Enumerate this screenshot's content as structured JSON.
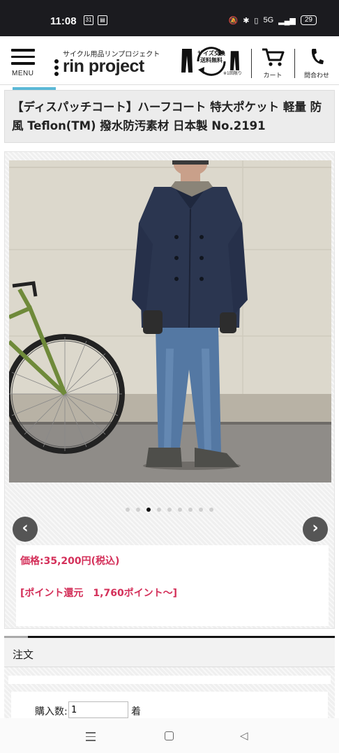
{
  "status_bar": {
    "time": "11:08",
    "calendar_day": "31",
    "battery": "29",
    "network": "5G"
  },
  "header": {
    "menu_label": "MENU",
    "logo_tagline": "サイクル用品リンプロジェクト",
    "logo_name": "rin project",
    "promo_line1": "サイズ交換",
    "promo_line2": "送料無料",
    "promo_note": "※1回限り",
    "cart_label": "カート",
    "contact_label": "問合わせ"
  },
  "product": {
    "title": "【ディスパッチコート】ハーフコート 特大ポケット 軽量 防風 Teflon(TM) 撥水防汚素材 日本製 No.2191",
    "carousel": {
      "count": 9,
      "active": 2
    },
    "price": "価格:35,200円(税込)",
    "points": "[ポイント還元　1,760ポイント〜]"
  },
  "order": {
    "heading": "注文",
    "qty_label": "購入数:",
    "qty_value": "1",
    "qty_unit": "着"
  },
  "colors": {
    "price": "#d4305a",
    "accent": "#5bb8d6",
    "header_bg": "#ffffff",
    "statusbar_bg": "#1b1b1f"
  }
}
